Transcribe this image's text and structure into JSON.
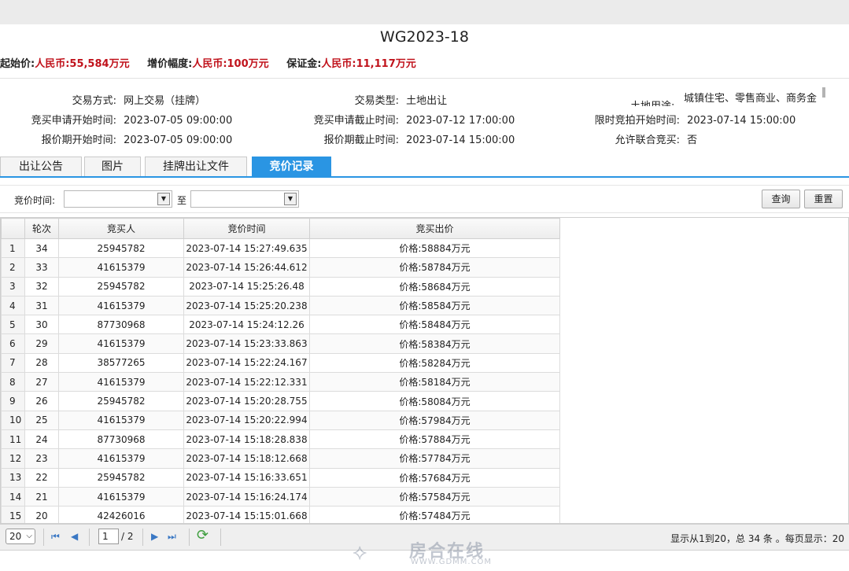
{
  "title": "WG2023-18",
  "price_info": {
    "start_label": "起始价:",
    "start_value": "人民币:55,584万元",
    "increment_label": "增价幅度:",
    "increment_value": "人民币:100万元",
    "deposit_label": "保证金:",
    "deposit_value": "人民币:11,117万元"
  },
  "details": {
    "trade_mode_label": "交易方式:",
    "trade_mode_value": "网上交易（挂牌）",
    "trade_type_label": "交易类型:",
    "trade_type_value": "土地出让",
    "land_use_label": "土地用途:",
    "land_use_value": "城镇住宅、零售商业、商务金",
    "apply_start_label": "竞买申请开始时间:",
    "apply_start_value": "2023-07-05 09:00:00",
    "apply_end_label": "竞买申请截止时间:",
    "apply_end_value": "2023-07-12 17:00:00",
    "auction_start_label": "限时竞拍开始时间:",
    "auction_start_value": "2023-07-14 15:00:00",
    "quote_start_label": "报价期开始时间:",
    "quote_start_value": "2023-07-05 09:00:00",
    "quote_end_label": "报价期截止时间:",
    "quote_end_value": "2023-07-14 15:00:00",
    "joint_label": "允许联合竞买:",
    "joint_value": "否"
  },
  "tabs": [
    "出让公告",
    "图片",
    "挂牌出让文件",
    "竞价记录"
  ],
  "filter": {
    "label": "竞价时间:",
    "to": "至",
    "query": "查询",
    "reset": "重置"
  },
  "columns": [
    "轮次",
    "竞买人",
    "竞价时间",
    "竞买出价"
  ],
  "rows": [
    [
      "1",
      "34",
      "25945782",
      "2023-07-14 15:27:49.635",
      "价格:58884万元"
    ],
    [
      "2",
      "33",
      "41615379",
      "2023-07-14 15:26:44.612",
      "价格:58784万元"
    ],
    [
      "3",
      "32",
      "25945782",
      "2023-07-14 15:25:26.48",
      "价格:58684万元"
    ],
    [
      "4",
      "31",
      "41615379",
      "2023-07-14 15:25:20.238",
      "价格:58584万元"
    ],
    [
      "5",
      "30",
      "87730968",
      "2023-07-14 15:24:12.26",
      "价格:58484万元"
    ],
    [
      "6",
      "29",
      "41615379",
      "2023-07-14 15:23:33.863",
      "价格:58384万元"
    ],
    [
      "7",
      "28",
      "38577265",
      "2023-07-14 15:22:24.167",
      "价格:58284万元"
    ],
    [
      "8",
      "27",
      "41615379",
      "2023-07-14 15:22:12.331",
      "价格:58184万元"
    ],
    [
      "9",
      "26",
      "25945782",
      "2023-07-14 15:20:28.755",
      "价格:58084万元"
    ],
    [
      "10",
      "25",
      "41615379",
      "2023-07-14 15:20:22.994",
      "价格:57984万元"
    ],
    [
      "11",
      "24",
      "87730968",
      "2023-07-14 15:18:28.838",
      "价格:57884万元"
    ],
    [
      "12",
      "23",
      "41615379",
      "2023-07-14 15:18:12.668",
      "价格:57784万元"
    ],
    [
      "13",
      "22",
      "25945782",
      "2023-07-14 15:16:33.651",
      "价格:57684万元"
    ],
    [
      "14",
      "21",
      "41615379",
      "2023-07-14 15:16:24.174",
      "价格:57584万元"
    ],
    [
      "15",
      "20",
      "42426016",
      "2023-07-14 15:15:01.668",
      "价格:57484万元"
    ]
  ],
  "pager": {
    "page_size": "20",
    "current_page": "1",
    "total_pages": "/ 2",
    "summary": "显示从1到20，总 34 条 。每页显示：20"
  },
  "watermark": {
    "brand": "房合在线",
    "url": "WWW.GDMM.COM"
  },
  "icons": {
    "dropdown": "chevron-down-icon",
    "first": "first-page-icon",
    "prev": "prev-page-icon",
    "next": "next-page-icon",
    "last": "last-page-icon",
    "refresh": "refresh-icon"
  },
  "colors": {
    "accent": "#2a95e3",
    "price_red": "#c0121b"
  }
}
